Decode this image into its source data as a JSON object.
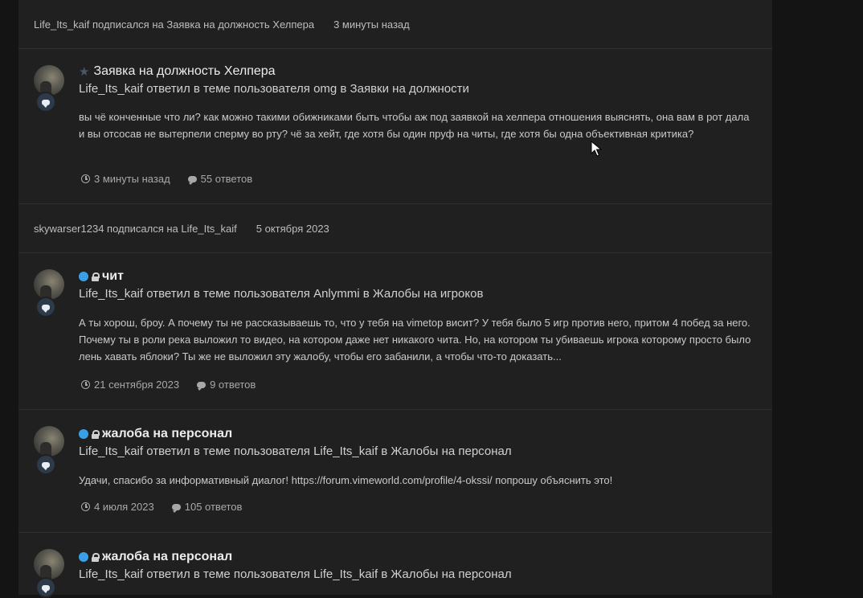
{
  "activity": {
    "system_rows": [
      {
        "text": "Life_Its_kaif подписался на Заявка на должность Хелпера",
        "time": "3 минуты назад"
      },
      {
        "text": "skywarser1234 подписался на Life_Its_kaif",
        "time": "5 октября 2023"
      }
    ],
    "entries": [
      {
        "title": "Заявка на должность Хелпера",
        "meta": "Life_Its_kaif ответил в теме пользователя omg в Заявки на должности",
        "snippet": "вы чё конченные что ли? как можно такими обижниками быть чтобы аж под заявкой на хелпера отношения выяснять, она вам в рот дала и вы отсосав не вытерпели сперму во рту? чё за хейт, где хотя бы один пруф на читы, где хотя бы одна объективная критика?",
        "time": "3 минуты назад",
        "replies": "55 ответов"
      },
      {
        "title": "чит",
        "meta": "Life_Its_kaif ответил в теме пользователя Anlymmi в Жалобы на игроков",
        "snippet": "А ты хорош, броу. А почему ты не рассказываешь то, что у тебя на vimetop висит? У тебя было 5 игр против него, притом 4 побед за него. Почему ты в роли река выложил то видео, на котором даже нет никакого чита. Но, на котором ты убиваешь игрока которому просто было лень хавать яблоки? Ты же не выложил эту жалобу, чтобы его забанили, а чтобы что-то доказать...",
        "time": "21 сентября 2023",
        "replies": "9 ответов"
      },
      {
        "title": "жалоба на персонал",
        "meta": "Life_Its_kaif ответил в теме пользователя Life_Its_kaif в Жалобы на персонал",
        "snippet": "Удачи, спасибо за информативный диалог! https://forum.vimeworld.com/profile/4-okssi/ попрошу объяснить это!",
        "time": "4 июля 2023",
        "replies": "105 ответов"
      },
      {
        "title": "жалоба на персонал",
        "meta": "Life_Its_kaif ответил в теме пользователя Life_Its_kaif в Жалобы на персонал"
      }
    ]
  },
  "icons": {
    "star": "star-icon",
    "unread": "unread-dot-icon",
    "locked": "lock-icon",
    "clock": "clock-icon",
    "comment": "comment-icon",
    "type": "reply-bubble-icon"
  },
  "colors": {
    "panel": "#202020",
    "background": "#141414",
    "unread_dot": "#3aa0e6"
  }
}
